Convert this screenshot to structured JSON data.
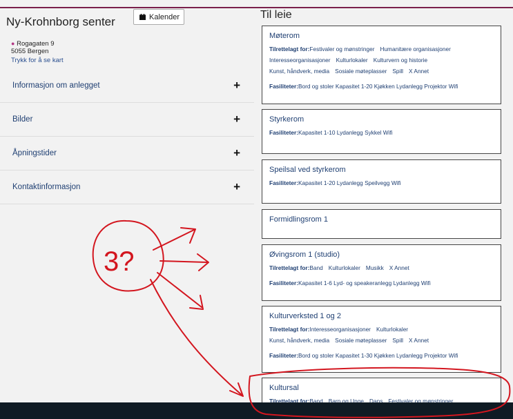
{
  "site": {
    "title": "Ny-Krohnborg senter",
    "calendar_button": "Kalender",
    "address_line1": "Rogagaten 9",
    "address_line2": "5055  Bergen",
    "map_link": "Trykk for å se kart"
  },
  "accordion": [
    {
      "label": "Informasjon om anlegget",
      "icon": "+"
    },
    {
      "label": "Bilder",
      "icon": "+"
    },
    {
      "label": "Åpningstider",
      "icon": "+"
    },
    {
      "label": "Kontaktinformasjon",
      "icon": "+"
    }
  ],
  "rent": {
    "heading": "Til leie",
    "tilrettelagt_label": "Tilrettelagt for:",
    "fasiliteter_label": "Fasiliteter:",
    "cards": [
      {
        "title": "Møterom",
        "tilrettelagt_rows": [
          [
            "Festivaler og mønstringer",
            "Humanitære organisasjoner"
          ],
          [
            "Interesseorganisasjoner",
            "Kulturlokaler",
            "Kulturvern og historie"
          ],
          [
            "Kunst, håndverk, media",
            "Sosiale møteplasser",
            "Spill",
            "X Annet"
          ]
        ],
        "fasiliteter": "Bord og stoler Kapasitet 1-20 Kjøkken Lydanlegg Projektor Wifi"
      },
      {
        "title": "Styrkerom",
        "fasiliteter": "Kapasitet 1-10 Lydanlegg Sykkel Wifi"
      },
      {
        "title": "Speilsal ved styrkerom",
        "fasiliteter": "Kapasitet 1-20 Lydanlegg Speilvegg Wifi"
      },
      {
        "title": "Formidlingsrom 1"
      },
      {
        "title": "Øvingsrom 1 (studio)",
        "tilrettelagt_rows": [
          [
            "Band",
            "Kulturlokaler",
            "Musikk",
            "X Annet"
          ]
        ],
        "fasiliteter": "Kapasitet 1-6 Lyd- og speakeranlegg Lydanlegg Wifi"
      },
      {
        "title": "Kulturverksted 1 og 2",
        "tilrettelagt_rows": [
          [
            "Interesseorganisasjoner",
            "Kulturlokaler"
          ],
          [
            "Kunst, håndverk, media",
            "Sosiale møteplasser",
            "Spill",
            "X Annet"
          ]
        ],
        "fasiliteter": "Bord og stoler Kapasitet 1-30 Kjøkken Lydanlegg Projektor Wifi"
      },
      {
        "title": "Kultursal",
        "tilrettelagt_rows": [
          [
            "Band",
            "Barn og Unge",
            "Dans",
            "Festivaler og mønstringer"
          ]
        ]
      }
    ]
  },
  "annotation": {
    "text": "3?",
    "color": "#d3161f"
  }
}
